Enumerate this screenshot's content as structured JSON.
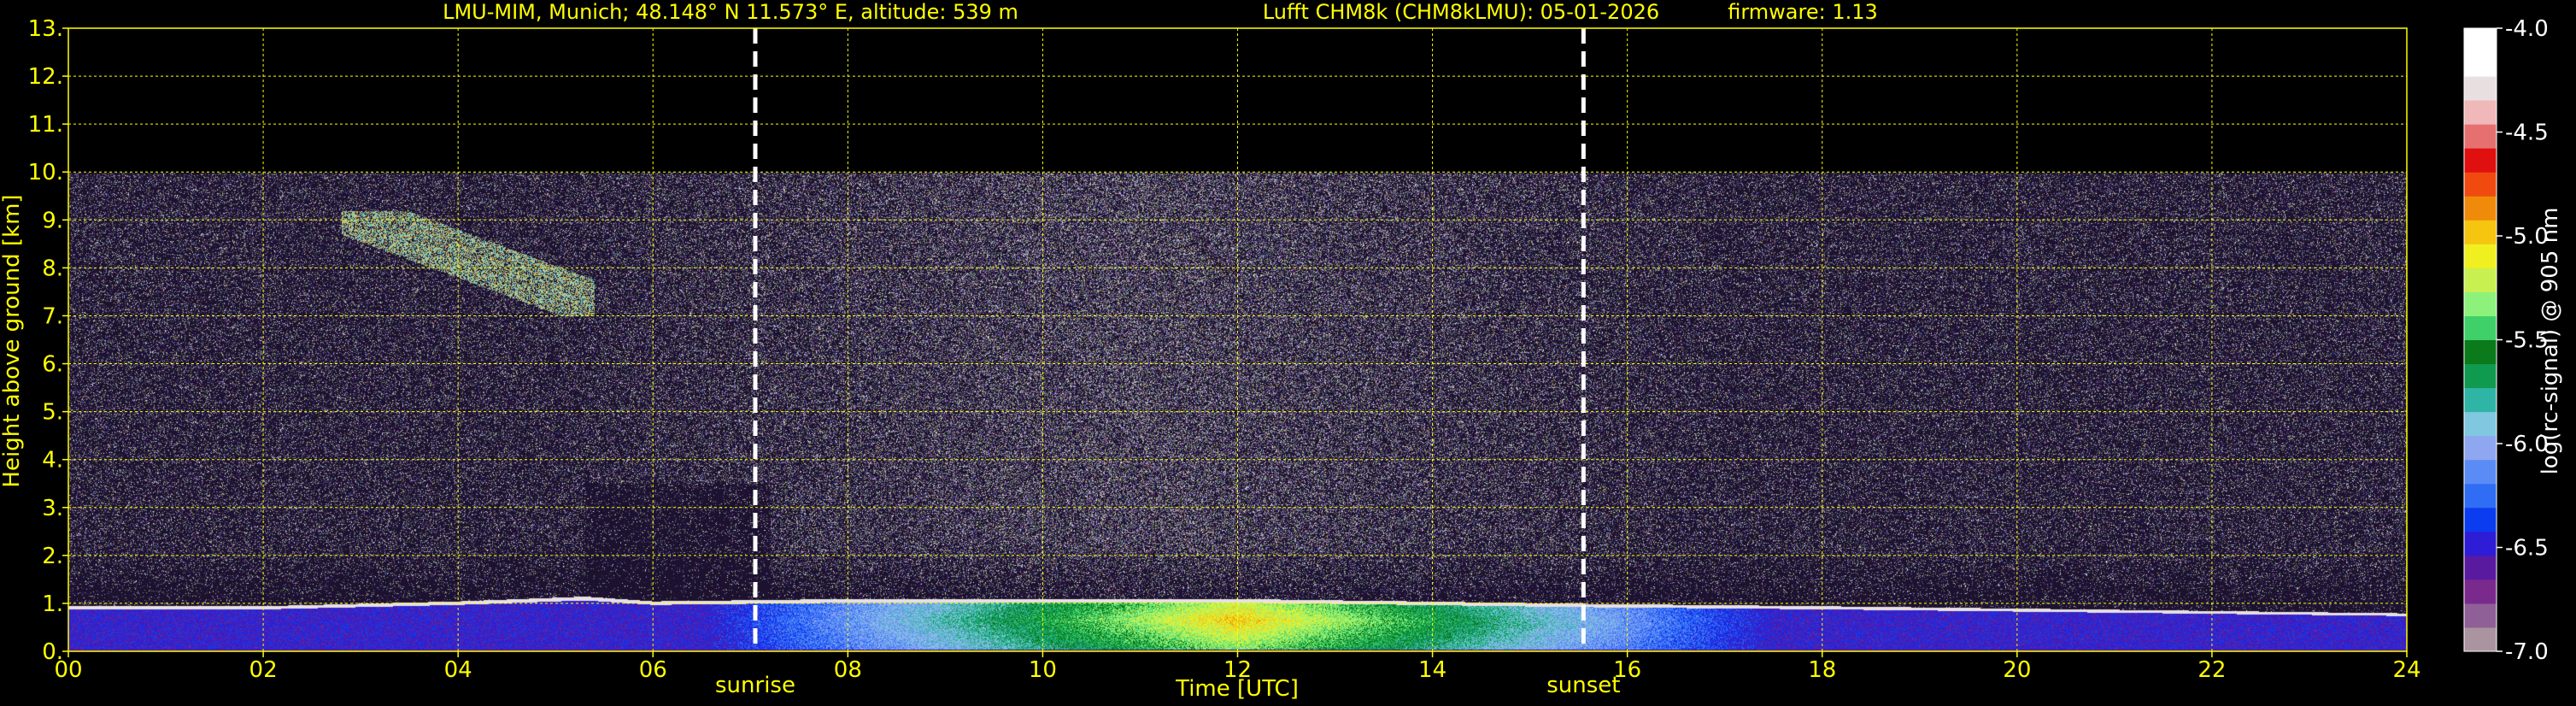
{
  "header": {
    "site": "LMU-MIM, Munich; 48.148° N 11.573° E, altitude: 539 m",
    "instrument": "Lufft CHM8k (CHM8kLMU): 05-01-2026",
    "firmware": "firmware: 1.13"
  },
  "chart_data": {
    "type": "heatmap",
    "title": "LMU-MIM, Munich; 48.148° N 11.573° E, altitude: 539 m    Lufft CHM8k (CHM8kLMU): 05-01-2026    firmware: 1.13",
    "xlabel": "Time [UTC]",
    "ylabel": "Height above ground [km]",
    "xlim": [
      0,
      24
    ],
    "ylim": [
      0,
      13
    ],
    "x_ticks": [
      0,
      2,
      4,
      6,
      8,
      10,
      12,
      14,
      16,
      18,
      20,
      22,
      24
    ],
    "x_tick_labels": [
      "00",
      "02",
      "04",
      "06",
      "08",
      "10",
      "12",
      "14",
      "16",
      "18",
      "20",
      "22",
      "24"
    ],
    "y_ticks": [
      0,
      1,
      2,
      3,
      4,
      5,
      6,
      7,
      8,
      9,
      10,
      11,
      12,
      13
    ],
    "y_tick_labels": [
      "0.",
      "1.",
      "2.",
      "3.",
      "4.",
      "5.",
      "6.",
      "7.",
      "8.",
      "9.",
      "10.",
      "11.",
      "12.",
      "13."
    ],
    "grid": true,
    "data_max_height_km": 10,
    "markers": [
      {
        "label": "sunrise",
        "x": 7.05
      },
      {
        "label": "sunset",
        "x": 15.55
      }
    ],
    "colorbar": {
      "label": "log(rc-signal) @ 905 nm",
      "range": [
        -7.0,
        -4.0
      ],
      "ticks": [
        -4.0,
        -4.5,
        -5.0,
        -5.5,
        -6.0,
        -6.5,
        -7.0
      ],
      "tick_labels": [
        "-4.0",
        "-4.5",
        "-5.0",
        "-5.5",
        "-6.0",
        "-6.5",
        "-7.0"
      ],
      "colors": [
        "#a9949f",
        "#8f5f98",
        "#7a2a8c",
        "#5a1aa0",
        "#2e1cd6",
        "#0b3cf0",
        "#2f6df5",
        "#5b8cf5",
        "#8ea7f0",
        "#7fc8e0",
        "#2fb5a5",
        "#0f9a50",
        "#0a7a1a",
        "#3fd06a",
        "#8df27c",
        "#c8f050",
        "#f0f020",
        "#f5c510",
        "#f08a0a",
        "#f04a10",
        "#e01010",
        "#e67070",
        "#f0b8b8",
        "#e8e0e0",
        "#ffffff",
        "#ffffff"
      ]
    },
    "boundary_layer": [
      {
        "t": 0.0,
        "top_km": 0.95
      },
      {
        "t": 2.0,
        "top_km": 0.95
      },
      {
        "t": 4.0,
        "top_km": 1.05
      },
      {
        "t": 5.3,
        "top_km": 1.15
      },
      {
        "t": 6.0,
        "top_km": 1.05
      },
      {
        "t": 8.0,
        "top_km": 1.1
      },
      {
        "t": 10.0,
        "top_km": 1.1
      },
      {
        "t": 12.0,
        "top_km": 1.1
      },
      {
        "t": 13.8,
        "top_km": 1.05
      },
      {
        "t": 15.5,
        "top_km": 1.0
      },
      {
        "t": 18.0,
        "top_km": 0.95
      },
      {
        "t": 20.0,
        "top_km": 0.9
      },
      {
        "t": 22.0,
        "top_km": 0.85
      },
      {
        "t": 24.0,
        "top_km": 0.8
      }
    ],
    "cloud_layer": {
      "t_start": 2.8,
      "t_end": 5.4,
      "base_km": 7.0,
      "top_km": 9.2
    }
  }
}
